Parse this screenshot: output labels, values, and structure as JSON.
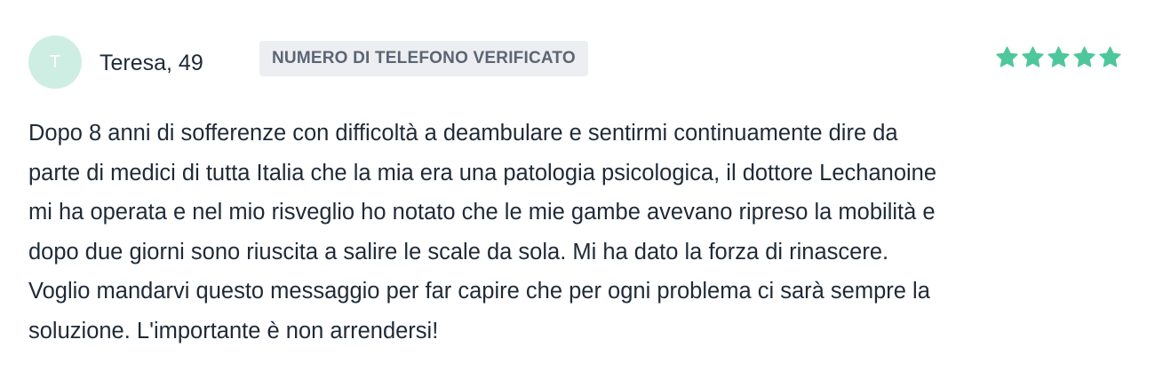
{
  "review": {
    "avatar_initial": "T",
    "reviewer_name": "Teresa, 49",
    "verified_badge": "NUMERO DI TELEFONO VERIFICATO",
    "rating": 5,
    "rating_max": 5,
    "star_color": "#4fc79c",
    "lines": [
      "Dopo 8 anni di sofferenze con difficoltà a deambulare e sentirmi continuamente dire da",
      "parte di medici di tutta Italia che la mia era una patologia psicologica, il dottore Lechanoine",
      "mi ha operata e nel mio risveglio ho notato che le mie gambe avevano ripreso la mobilità e",
      "dopo due giorni sono riuscita a salire le scale da sola. Mi ha dato la forza di rinascere.",
      "Voglio mandarvi questo messaggio per far capire che per ogni problema ci sarà sempre la",
      "soluzione. L'importante è non arrendersi!"
    ]
  }
}
